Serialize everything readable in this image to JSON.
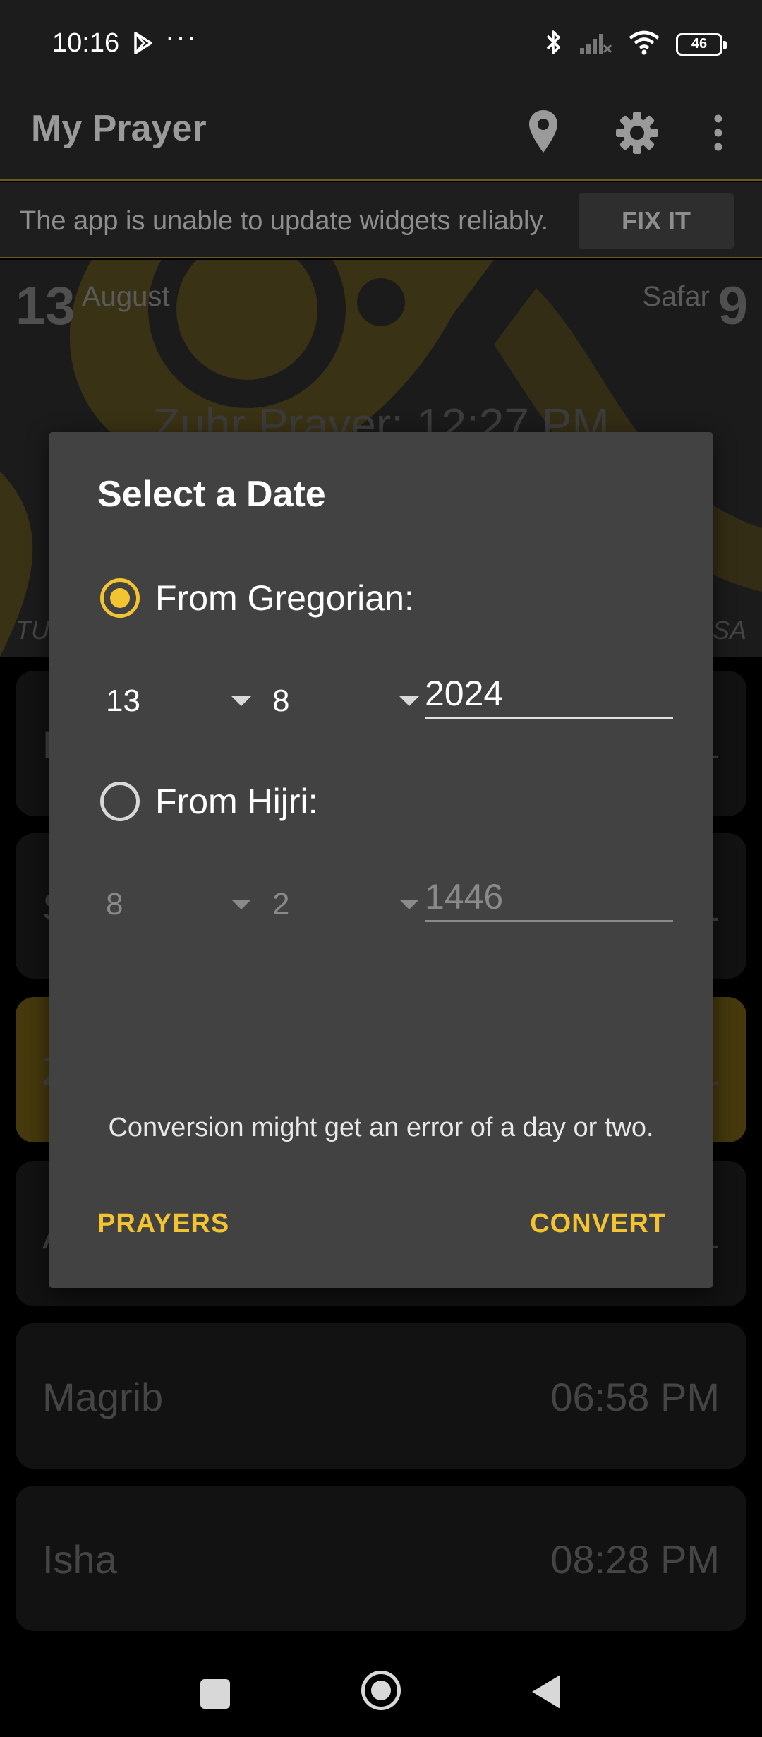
{
  "status_bar": {
    "time": "10:16",
    "dots": "···",
    "battery": "46"
  },
  "app_bar": {
    "title": "My Prayer",
    "icons": [
      "location-pin-icon",
      "gear-icon",
      "more-vert-icon"
    ]
  },
  "banner": {
    "text": "The app is unable to update widgets reliably.",
    "button": "FIX IT"
  },
  "header": {
    "gregorian_day": "13",
    "gregorian_month": "August",
    "hijri_month": "Safar",
    "hijri_day": "9",
    "next_prayer": "Zuhr Prayer: 12:27 PM",
    "weekday_left": "TU",
    "weekday_right": "SA"
  },
  "prayers": [
    {
      "name": "F",
      "time": "1"
    },
    {
      "name": "S",
      "time": "1"
    },
    {
      "name": "Z",
      "time": "1"
    },
    {
      "name": "A",
      "time": "1"
    },
    {
      "name": "Magrib",
      "time": "06:58 PM"
    },
    {
      "name": "Isha",
      "time": "08:28 PM"
    }
  ],
  "dialog": {
    "title": "Select a Date",
    "gregorian": {
      "label": "From Gregorian:",
      "selected": true,
      "day": "13",
      "month": "8",
      "year": "2024"
    },
    "hijri": {
      "label": "From Hijri:",
      "selected": false,
      "day": "8",
      "month": "2",
      "year": "1446"
    },
    "note": "Conversion might get an error of a day or two.",
    "buttons": {
      "left": "PRAYERS",
      "right": "CONVERT"
    }
  },
  "colors": {
    "accent": "#f4c430",
    "dialog_bg": "#424242",
    "active_row": "#6a5814"
  }
}
